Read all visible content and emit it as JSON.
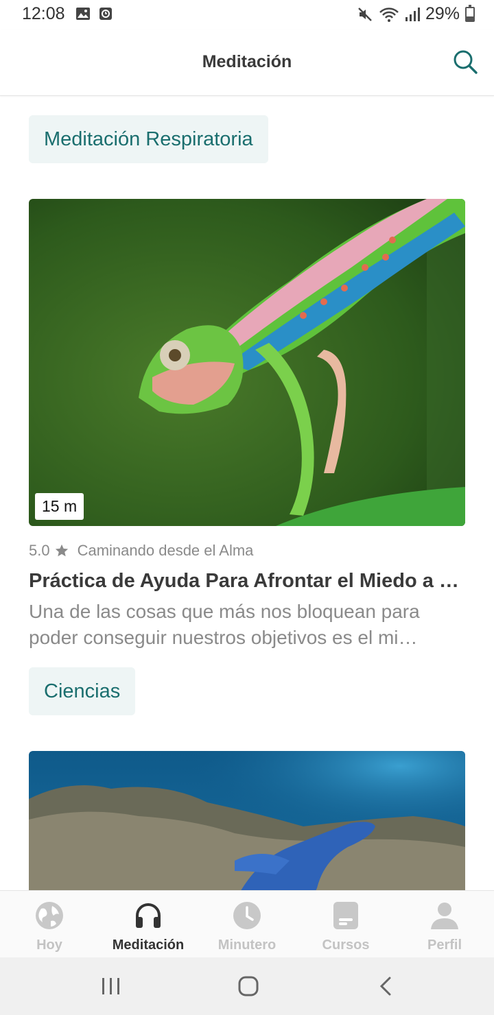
{
  "status_bar": {
    "time": "12:08",
    "battery": "29%",
    "battery_level": 0.29,
    "icons": [
      "gallery-icon",
      "clock-app-icon",
      "mute-icon",
      "wifi-icon",
      "signal-icon",
      "battery-icon"
    ]
  },
  "app_bar": {
    "title": "Meditación",
    "search_icon": "search-icon"
  },
  "content": {
    "category_1": "Meditación Respiratoria",
    "card": {
      "duration": "15 m",
      "rating": "5.0",
      "rating_icon": "star-icon",
      "author": "Caminando desde el Alma",
      "title": "Práctica de Ayuda Para Afrontar el Miedo a …",
      "description": "Una de las cosas que más nos bloquean para poder conseguir nuestros objetivos es el mi…"
    },
    "category_2": "Ciencias"
  },
  "bottom_nav": {
    "items": [
      {
        "label": "Hoy",
        "icon": "globe-icon",
        "active": false
      },
      {
        "label": "Meditación",
        "icon": "headphones-icon",
        "active": true
      },
      {
        "label": "Minutero",
        "icon": "clock-icon",
        "active": false
      },
      {
        "label": "Cursos",
        "icon": "course-icon",
        "active": false
      },
      {
        "label": "Perfil",
        "icon": "person-icon",
        "active": false
      }
    ]
  },
  "colors": {
    "accent": "#1a6e6e",
    "chip_bg": "#eef5f5",
    "nav_inactive": "#c3c3c3",
    "nav_active": "#333333"
  }
}
